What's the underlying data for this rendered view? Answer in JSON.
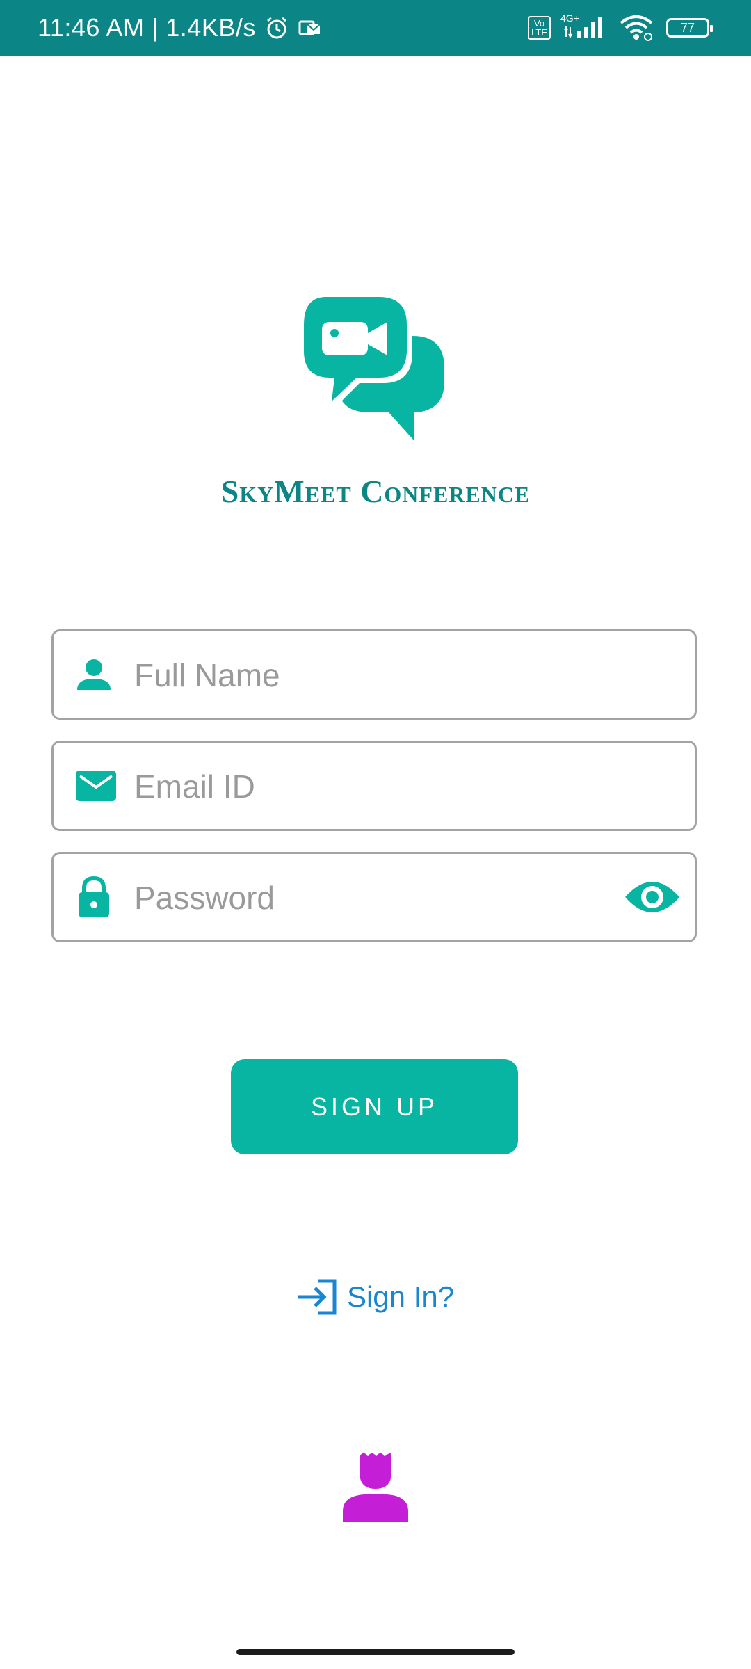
{
  "status_bar": {
    "time": "11:46 AM | 1.4KB/s",
    "volte": "Vo\nLTE",
    "network": "4G+",
    "battery": "77"
  },
  "app": {
    "title": "SkyMeet Conference"
  },
  "form": {
    "full_name_placeholder": "Full Name",
    "email_placeholder": "Email ID",
    "password_placeholder": "Password",
    "signup_label": "SIGN UP"
  },
  "signin": {
    "label": "Sign In?"
  },
  "colors": {
    "status_bar": "#0b8585",
    "accent": "#08b4a2",
    "link": "#1a86d0",
    "user_icon": "#c41fd6"
  }
}
